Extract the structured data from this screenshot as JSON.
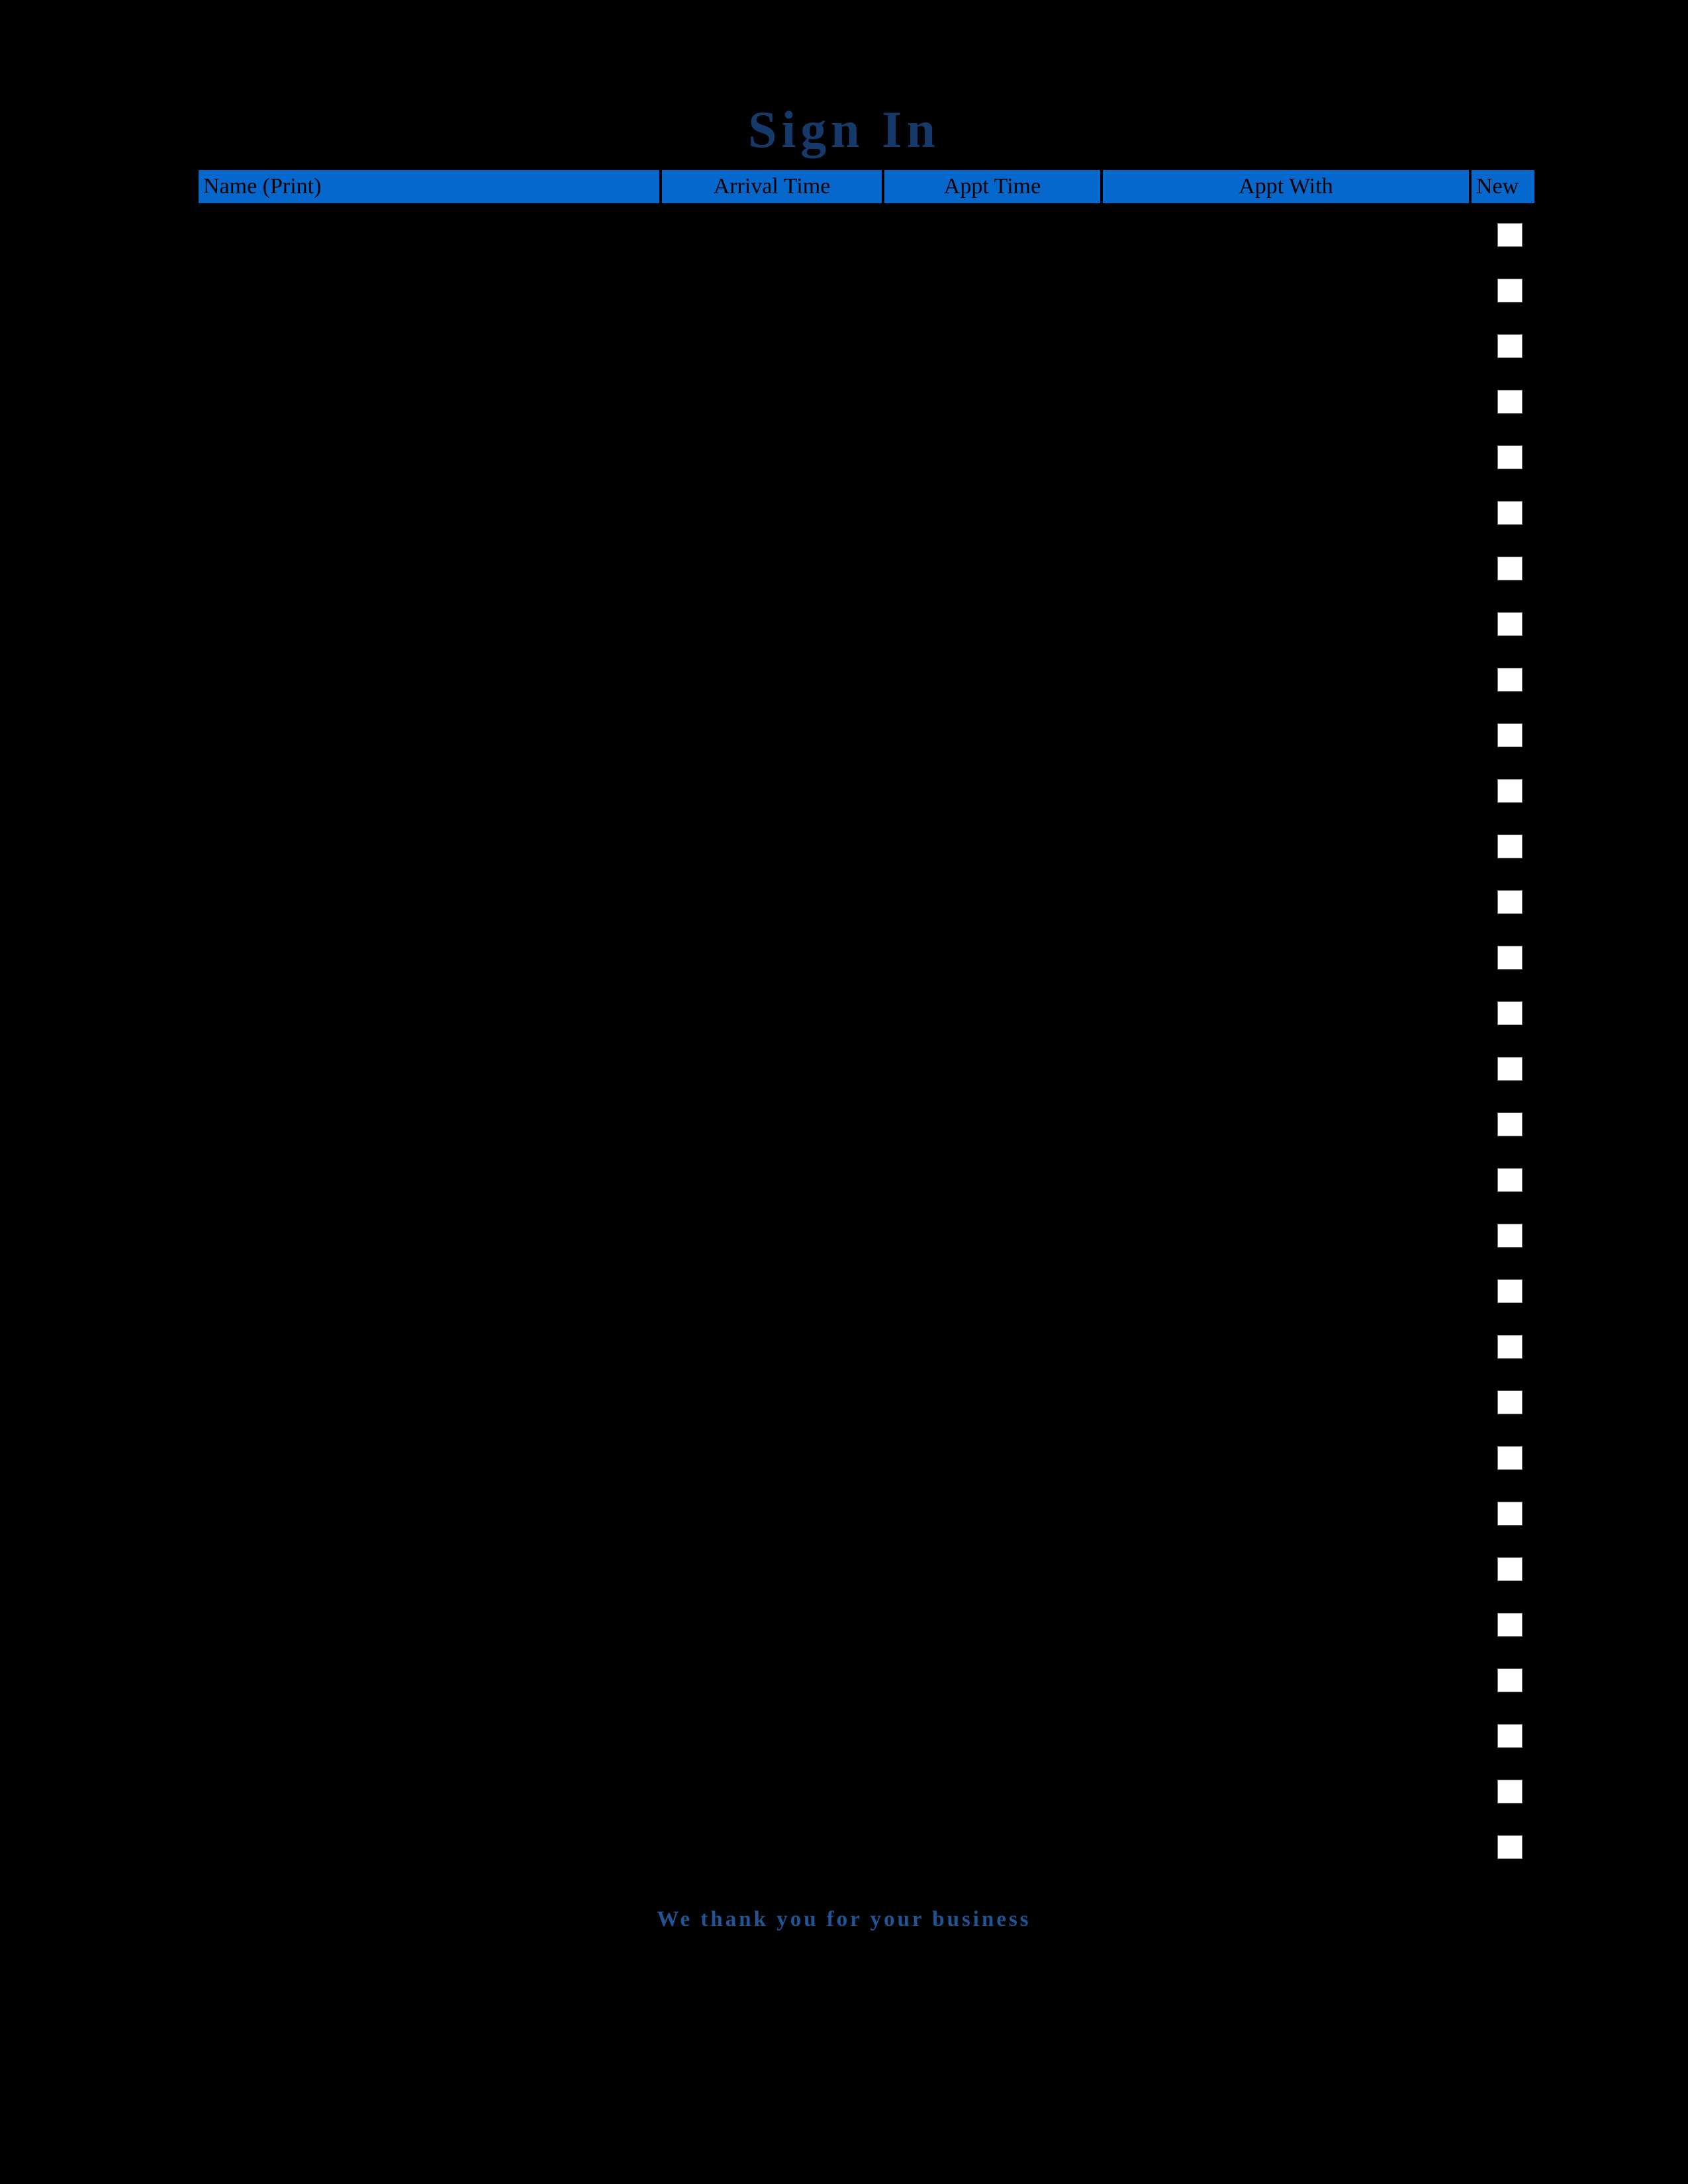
{
  "page": {
    "title": "Sign In",
    "background_color": "#000000",
    "title_color": "#15396B",
    "header_fill_color": "#0668cc",
    "footer_color": "#1F5496",
    "checkbox_fill_color": "#ffffff"
  },
  "table": {
    "columns": [
      {
        "id": "name",
        "label": "Name (Print)",
        "align": "left"
      },
      {
        "id": "arrival",
        "label": "Arrival Time",
        "align": "center"
      },
      {
        "id": "appt",
        "label": "Appt Time",
        "align": "center"
      },
      {
        "id": "with",
        "label": "Appt With",
        "align": "center"
      },
      {
        "id": "new",
        "label": "New",
        "align": "left"
      }
    ],
    "rows": [
      {
        "name": "",
        "arrival": "",
        "appt": "",
        "with": "",
        "new": false
      },
      {
        "name": "",
        "arrival": "",
        "appt": "",
        "with": "",
        "new": false
      },
      {
        "name": "",
        "arrival": "",
        "appt": "",
        "with": "",
        "new": false
      },
      {
        "name": "",
        "arrival": "",
        "appt": "",
        "with": "",
        "new": false
      },
      {
        "name": "",
        "arrival": "",
        "appt": "",
        "with": "",
        "new": false
      },
      {
        "name": "",
        "arrival": "",
        "appt": "",
        "with": "",
        "new": false
      },
      {
        "name": "",
        "arrival": "",
        "appt": "",
        "with": "",
        "new": false
      },
      {
        "name": "",
        "arrival": "",
        "appt": "",
        "with": "",
        "new": false
      },
      {
        "name": "",
        "arrival": "",
        "appt": "",
        "with": "",
        "new": false
      },
      {
        "name": "",
        "arrival": "",
        "appt": "",
        "with": "",
        "new": false
      },
      {
        "name": "",
        "arrival": "",
        "appt": "",
        "with": "",
        "new": false
      },
      {
        "name": "",
        "arrival": "",
        "appt": "",
        "with": "",
        "new": false
      },
      {
        "name": "",
        "arrival": "",
        "appt": "",
        "with": "",
        "new": false
      },
      {
        "name": "",
        "arrival": "",
        "appt": "",
        "with": "",
        "new": false
      },
      {
        "name": "",
        "arrival": "",
        "appt": "",
        "with": "",
        "new": false
      },
      {
        "name": "",
        "arrival": "",
        "appt": "",
        "with": "",
        "new": false
      },
      {
        "name": "",
        "arrival": "",
        "appt": "",
        "with": "",
        "new": false
      },
      {
        "name": "",
        "arrival": "",
        "appt": "",
        "with": "",
        "new": false
      },
      {
        "name": "",
        "arrival": "",
        "appt": "",
        "with": "",
        "new": false
      },
      {
        "name": "",
        "arrival": "",
        "appt": "",
        "with": "",
        "new": false
      },
      {
        "name": "",
        "arrival": "",
        "appt": "",
        "with": "",
        "new": false
      },
      {
        "name": "",
        "arrival": "",
        "appt": "",
        "with": "",
        "new": false
      },
      {
        "name": "",
        "arrival": "",
        "appt": "",
        "with": "",
        "new": false
      },
      {
        "name": "",
        "arrival": "",
        "appt": "",
        "with": "",
        "new": false
      },
      {
        "name": "",
        "arrival": "",
        "appt": "",
        "with": "",
        "new": false
      },
      {
        "name": "",
        "arrival": "",
        "appt": "",
        "with": "",
        "new": false
      },
      {
        "name": "",
        "arrival": "",
        "appt": "",
        "with": "",
        "new": false
      },
      {
        "name": "",
        "arrival": "",
        "appt": "",
        "with": "",
        "new": false
      },
      {
        "name": "",
        "arrival": "",
        "appt": "",
        "with": "",
        "new": false
      },
      {
        "name": "",
        "arrival": "",
        "appt": "",
        "with": "",
        "new": false
      }
    ]
  },
  "footer": {
    "message": "We thank you for your business"
  }
}
